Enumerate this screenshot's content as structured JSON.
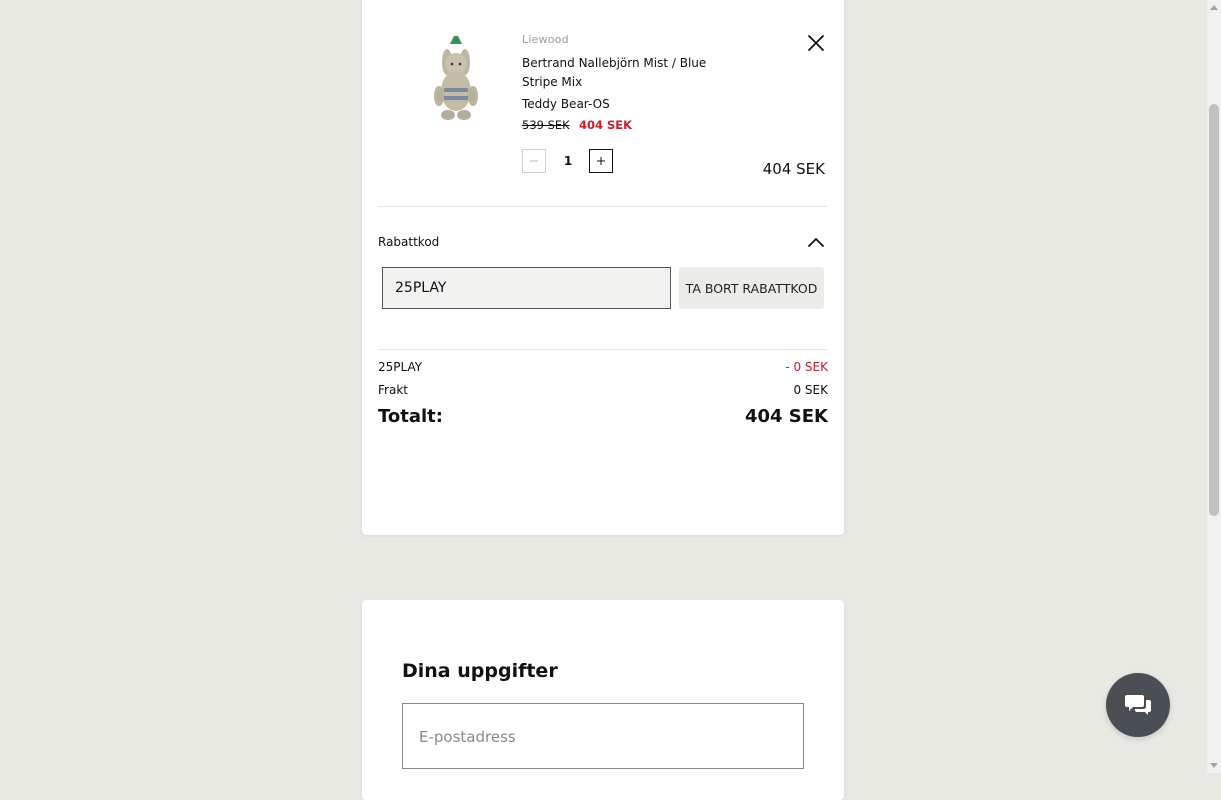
{
  "cart": {
    "item": {
      "brand": "Liewood",
      "name": "Bertrand Nallebjörn Mist / Blue Stripe Mix",
      "variant": "Teddy Bear-OS",
      "old_price": "539 SEK",
      "new_price": "404 SEK",
      "quantity": "1",
      "line_total": "404 SEK",
      "image_icon": "teddy-bunny-plush",
      "remove_icon": "close-icon"
    },
    "discount": {
      "label": "Rabattkod",
      "code_value": "25PLAY",
      "remove_button": "TA BORT RABATTKOD"
    },
    "summary": {
      "discount_label": "25PLAY",
      "discount_value": "- 0 SEK",
      "shipping_label": "Frakt",
      "shipping_value": "0 SEK",
      "total_label": "Totalt:",
      "total_value": "404 SEK"
    }
  },
  "details": {
    "title": "Dina uppgifter",
    "email_placeholder": "E-postadress"
  },
  "chat": {
    "icon": "chat-bubbles-icon"
  },
  "colors": {
    "page_bg": "#e9e9e4",
    "card_bg": "#ffffff",
    "sale_red": "#c0202b",
    "chat_bg": "#4a4f55"
  }
}
